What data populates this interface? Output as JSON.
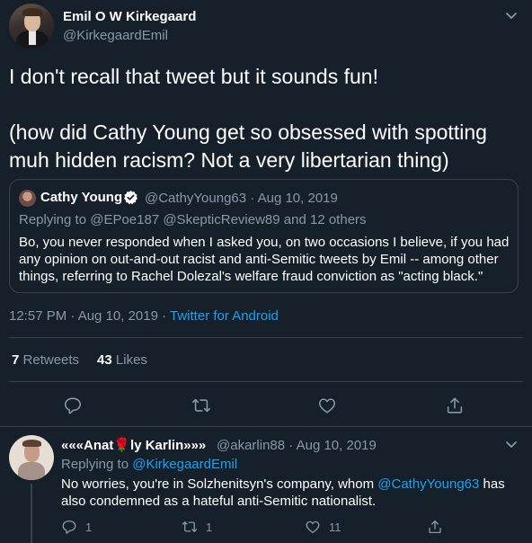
{
  "main_tweet": {
    "author_name": "Emil O W Kirkegaard",
    "author_handle": "@KirkegaardEmil",
    "text_line1": "I don't recall that tweet but it sounds fun!",
    "text_line2": "(how did Cathy Young get so obsessed with spotting muh hidden racism? Not a very libertarian thing)",
    "timestamp": "12:57 PM · Aug 10, 2019 · ",
    "source": "Twitter for Android",
    "retweets_count": "7",
    "retweets_label": "Retweets",
    "likes_count": "43",
    "likes_label": "Likes"
  },
  "quoted_tweet": {
    "author_name": "Cathy Young",
    "author_handle": "@CathyYoung63 · Aug 10, 2019",
    "replying_prefix": "Replying to ",
    "replying_to": "@EPoe187 @SkepticReview89",
    "replying_suffix": " and 12 others",
    "text": "Bo, you never responded when I asked you, on two occasions I believe, if you had any opinion on out-and-out racist and anti-Semitic tweets by Emil -- among other things, referring to Rachel Dolezal's welfare fraud conviction as \"acting black.\""
  },
  "reply_tweet": {
    "author_name_pre": "«««Anat",
    "author_name_rose": "🌹",
    "author_name_post": "ly Karlin»»»",
    "author_handle": "@akarlin88 · Aug 10, 2019",
    "replying_prefix": "Replying to ",
    "replying_to": "@KirkegaardEmil",
    "text_part1": "No worries, you're in Solzhenitsyn's company, whom ",
    "text_mention": "@CathyYoung63",
    "text_part2": " has also condemned as a hateful anti-Semitic nationalist.",
    "reply_count": "1",
    "retweet_count": "1",
    "like_count": "11"
  },
  "colors": {
    "background": "#15202b",
    "accent": "#1da1f2",
    "muted": "#8899a6",
    "border": "#38444d"
  },
  "icons": [
    "chevron-down-icon",
    "verified-badge-icon",
    "reply-icon",
    "retweet-icon",
    "like-icon",
    "share-icon"
  ]
}
